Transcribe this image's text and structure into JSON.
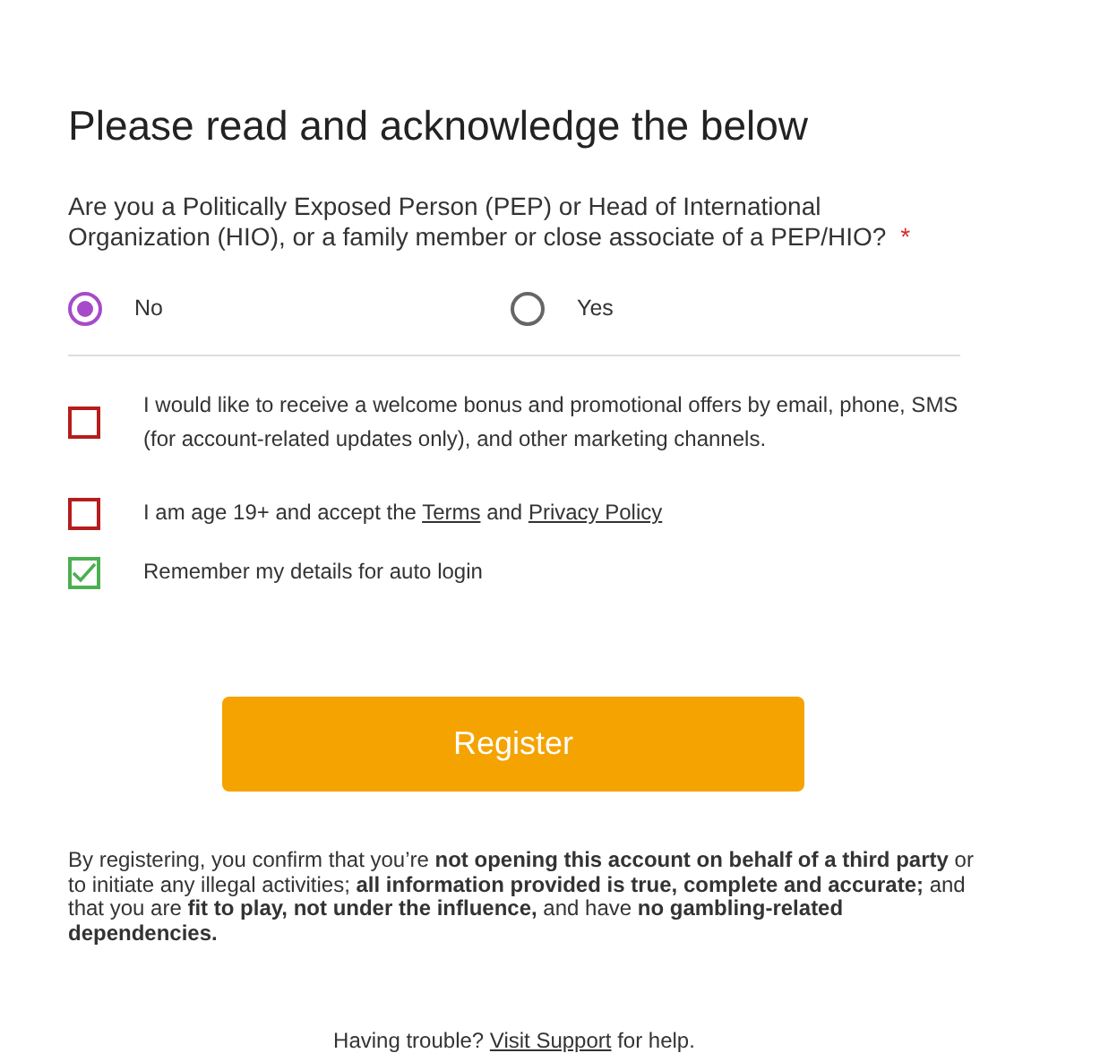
{
  "title": "Please read and acknowledge the below",
  "question": {
    "text": "Are you a Politically Exposed Person (PEP) or Head of International Organization (HIO), or a family member or close associate of a PEP/HIO?",
    "required_mark": "*"
  },
  "options": [
    {
      "label": "No",
      "selected": true
    },
    {
      "label": "Yes",
      "selected": false
    }
  ],
  "checkboxes": [
    {
      "parts": [
        {
          "kind": "text",
          "text": "I would like to receive a welcome bonus and promotional offers by email, phone, SMS (for account-related updates only), and other marketing channels."
        }
      ],
      "checked": false
    },
    {
      "parts": [
        {
          "kind": "text",
          "text": "I am age 19+ and accept the "
        },
        {
          "kind": "link",
          "text": "Terms"
        },
        {
          "kind": "text",
          "text": " and "
        },
        {
          "kind": "link",
          "text": "Privacy Policy"
        }
      ],
      "checked": false
    },
    {
      "parts": [
        {
          "kind": "text",
          "text": "Remember my details for auto login"
        }
      ],
      "checked": true
    }
  ],
  "register_button": "Register",
  "disclaimer": "By registering, you confirm that you’re **not opening this account on behalf of a third party** or to initiate any illegal activities; **all information provided is true, complete and accurate;** and that you are **fit to play, not under the influence,** and have **no gambling-related dependencies.**",
  "footer": [
    {
      "kind": "text",
      "text": "Having trouble? "
    },
    {
      "kind": "link",
      "text": "Visit Support"
    },
    {
      "kind": "text",
      "text": " for help."
    }
  ]
}
